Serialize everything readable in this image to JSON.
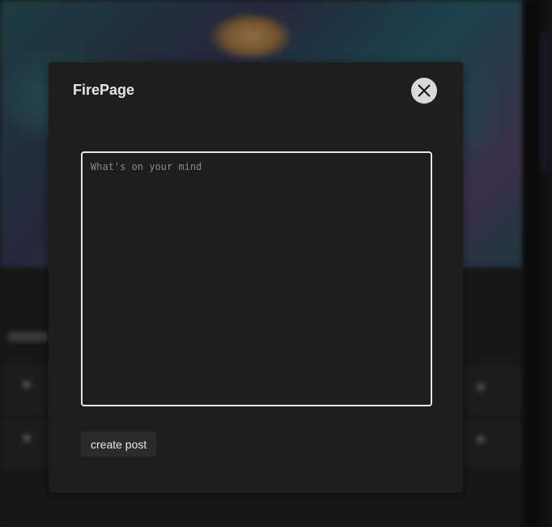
{
  "modal": {
    "title": "FirePage",
    "close_icon": "close-icon",
    "post_input": {
      "value": "",
      "placeholder": "What's on your mind"
    },
    "create_button_label": "create post"
  },
  "colors": {
    "modal_background": "#1e1e1e",
    "close_button_background": "#d9d9d9",
    "textarea_border": "#e8e8e8",
    "button_background": "#2b2b2b",
    "text": "#e6e6e6"
  }
}
